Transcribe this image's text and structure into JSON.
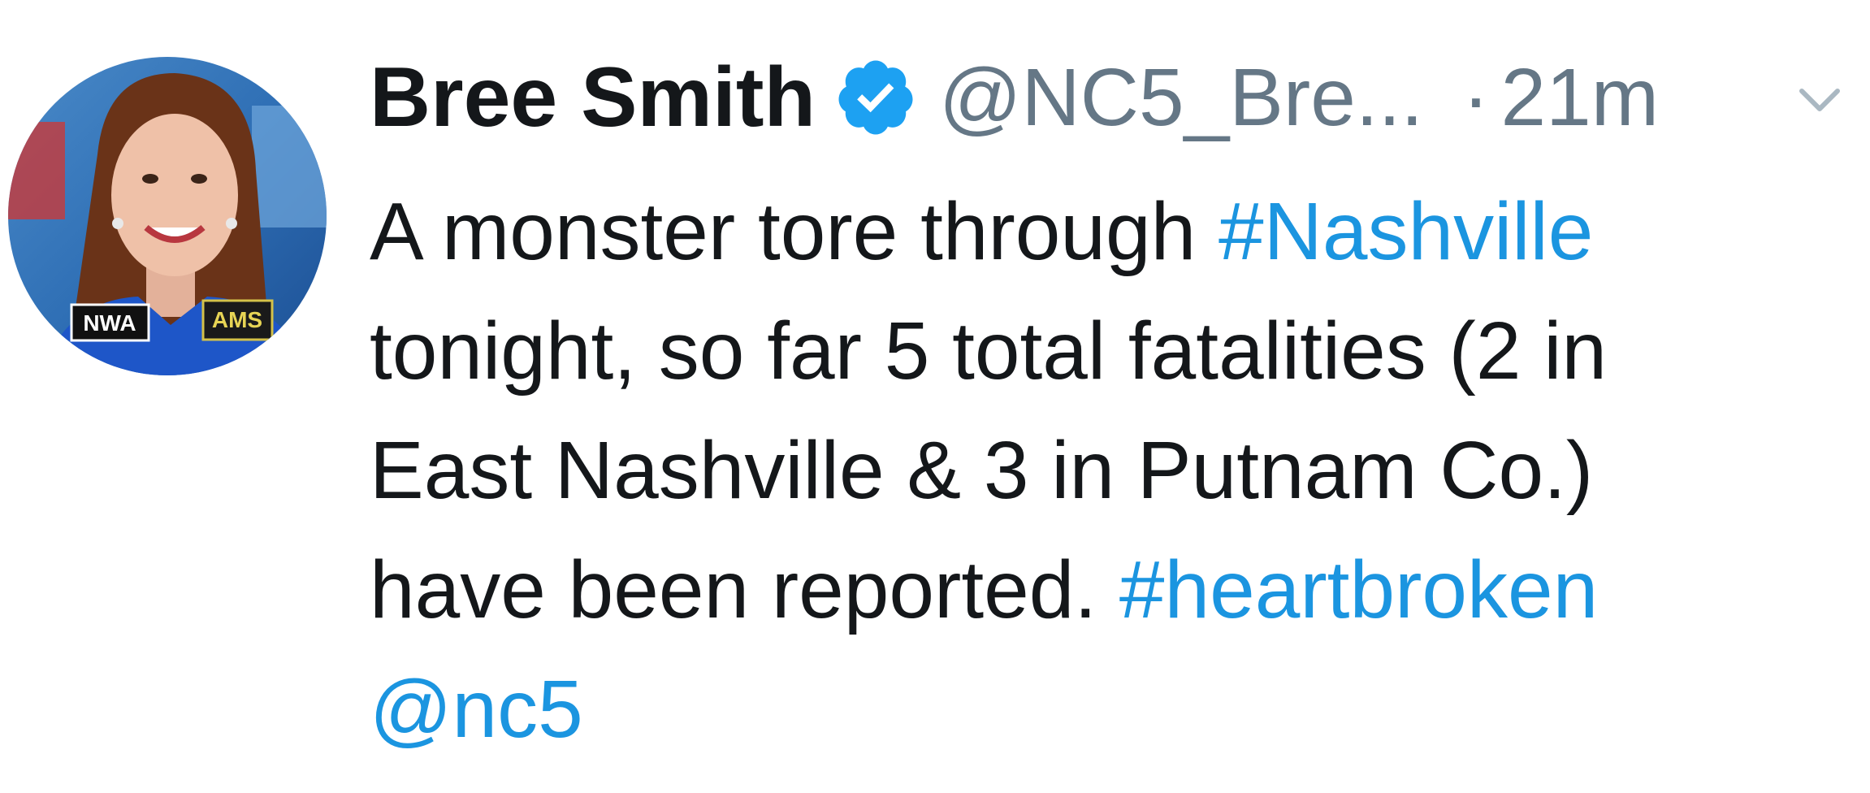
{
  "tweet": {
    "display_name": "Bree Smith",
    "handle": "@NC5_Bre...",
    "separator": "·",
    "time": "21m",
    "badges": {
      "left": "NWA",
      "right": "AMS"
    },
    "lines": [
      {
        "text": "A monster tore through ",
        "hashtag": "#Nashville"
      },
      {
        "text": "tonight, so far 5 total fatalities (2 in"
      },
      {
        "text": "East Nashville & 3 in Putnam Co.)"
      },
      {
        "text": "have been reported. ",
        "hashtag": "#heartbroken"
      },
      {
        "mention": "@nc5"
      }
    ]
  },
  "colors": {
    "text": "#14171a",
    "muted": "#657786",
    "link": "#1b95e0",
    "verified": "#1da1f2"
  },
  "icons": {
    "verified": "verified-badge-icon",
    "caret": "chevron-down-icon"
  }
}
